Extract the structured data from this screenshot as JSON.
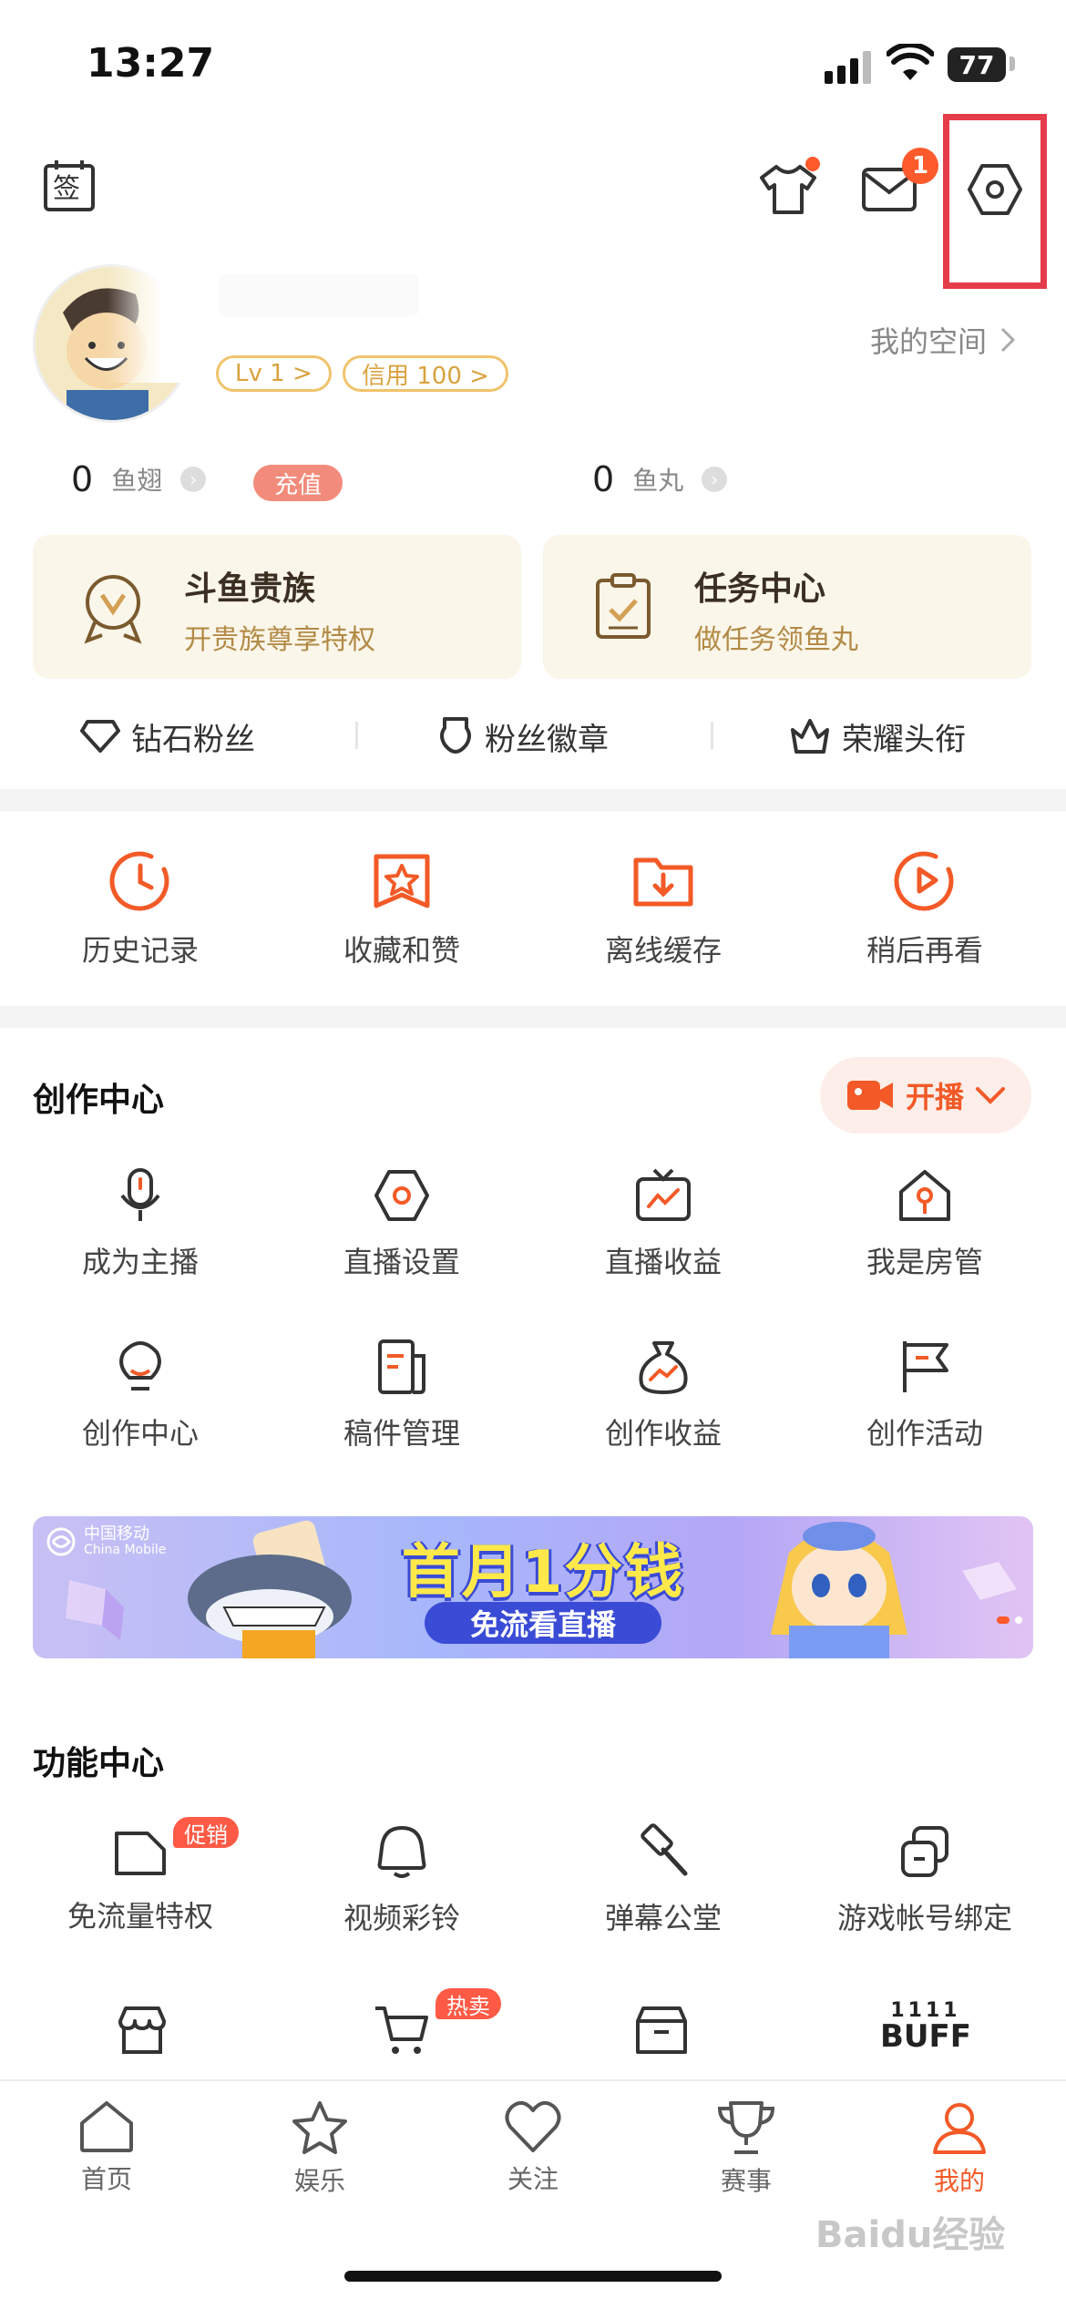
{
  "status_bar": {
    "time": "13:27",
    "battery": "77"
  },
  "header": {
    "sign_in_glyph": "签",
    "message_badge": "1"
  },
  "profile": {
    "level": "Lv 1 >",
    "credit": "信用 100 >",
    "my_space": "我的空间"
  },
  "currency": [
    {
      "value": "0",
      "label": "鱼翅"
    },
    {
      "value": "0",
      "label": "鱼丸"
    }
  ],
  "recharge_label": "充值",
  "cards": [
    {
      "title": "斗鱼贵族",
      "subtitle": "开贵族尊享特权"
    },
    {
      "title": "任务中心",
      "subtitle": "做任务领鱼丸"
    }
  ],
  "fan_items": [
    {
      "label": "钻石粉丝"
    },
    {
      "label": "粉丝徽章"
    },
    {
      "label": "荣耀头衔"
    }
  ],
  "quick_actions": [
    {
      "label": "历史记录"
    },
    {
      "label": "收藏和赞"
    },
    {
      "label": "离线缓存"
    },
    {
      "label": "稍后再看"
    }
  ],
  "creation_center": {
    "title": "创作中心",
    "live_button": "开播",
    "items": [
      {
        "label": "成为主播"
      },
      {
        "label": "直播设置"
      },
      {
        "label": "直播收益"
      },
      {
        "label": "我是房管"
      },
      {
        "label": "创作中心"
      },
      {
        "label": "稿件管理"
      },
      {
        "label": "创作收益"
      },
      {
        "label": "创作活动"
      }
    ]
  },
  "banner": {
    "brand_cn": "中国移动",
    "brand_en": "China Mobile",
    "headline": "首月1分钱",
    "subline": "免流看直播"
  },
  "function_center": {
    "title": "功能中心",
    "items": [
      {
        "label": "免流量特权",
        "tag": "促销"
      },
      {
        "label": "视频彩铃",
        "tag": ""
      },
      {
        "label": "弹幕公堂",
        "tag": ""
      },
      {
        "label": "游戏帐号绑定",
        "tag": ""
      }
    ],
    "row2_tag": "热卖",
    "buff_text": "BUFF",
    "buff_top": "1111"
  },
  "tabbar": [
    {
      "label": "首页"
    },
    {
      "label": "娱乐"
    },
    {
      "label": "关注"
    },
    {
      "label": "赛事"
    },
    {
      "label": "我的"
    }
  ],
  "watermark": "Baidu经验",
  "colors": {
    "accent": "#f35a27",
    "highlight_box": "#e53c4c",
    "card_bg": "#fbf6ea"
  }
}
